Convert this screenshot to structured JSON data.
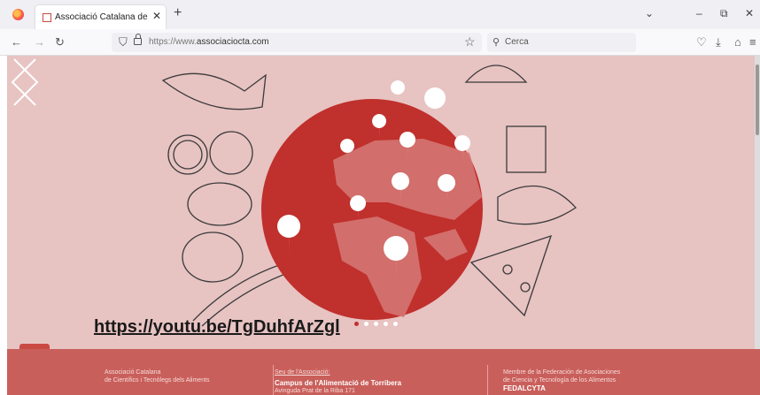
{
  "tab": {
    "title": "Associació Catalana de Científic",
    "close_glyph": "✕",
    "new_tab_glyph": "+"
  },
  "window_controls": {
    "list_all_tabs": "⌄",
    "minimize": "–",
    "restore": "⧉",
    "close": "✕"
  },
  "nav": {
    "back": "←",
    "forward": "→",
    "reload": "↻",
    "url_scheme": "https://www.",
    "url_domain": "associaciocta.com"
  },
  "search": {
    "placeholder": "Cerca",
    "icon": "search-icon"
  },
  "toolbar_icons": [
    "pocket-icon",
    "download-icon",
    "extensions-icon",
    "menu-icon"
  ],
  "hero": {
    "video_link": "https://youtu.be/TgDuhfArZgl",
    "slide_count": 5,
    "active_slide": 1
  },
  "footer": {
    "col1_line1": "Associació Catalana",
    "col1_line2": "de Científics i Tecnòlegs dels Aliments",
    "col2_link": "Seu de l'Associació:",
    "col2_strong": "Campus de l'Alimentació de Torribera",
    "col2_line": "Avinguda Prat de la Riba 171",
    "col3_line1": "Membre de la Federación de Asociaciones",
    "col3_line2": "de Ciencia y Tecnología de los Alimentos",
    "col3_strong": "FEDALCYTA"
  },
  "colors": {
    "hero_bg": "#e7c3c2",
    "globe": "#c0302c",
    "footer_bg": "#c95f5b"
  }
}
